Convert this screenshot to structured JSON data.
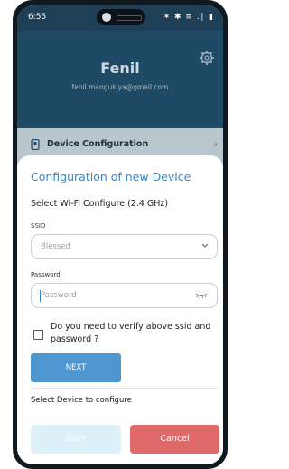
{
  "status_bar": {
    "time": "6:55",
    "icons": "✶ ✱ ≡ .∣ ▮"
  },
  "profile": {
    "name": "Fenil",
    "email": "fenil.mangukiya@gmail.com"
  },
  "menu": {
    "device_configuration_label": "Device Configuration"
  },
  "dialog": {
    "title": "Configuration of new Device",
    "wifi_heading": "Select Wi-Fi Configure (2.4 GHz)",
    "ssid_label": "SSID",
    "ssid_value": "Blessed",
    "password_label": "Password",
    "password_placeholder": "Password",
    "verify_text": "Do you need to verify above ssid and password ?",
    "next_label": "NEXT",
    "select_device_label": "Select Device to configure",
    "start_label": "Start",
    "cancel_label": "Cancel"
  },
  "colors": {
    "header_bg": "#1e4a66",
    "accent": "#3a86c6",
    "next_button": "#4f97d1",
    "cancel_button": "#e06a6a",
    "start_button_disabled": "#dff1f8"
  }
}
